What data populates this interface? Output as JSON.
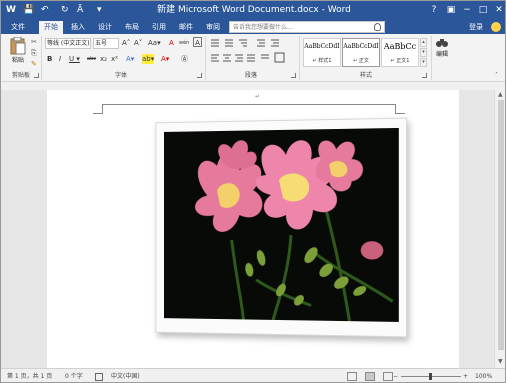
{
  "window": {
    "title": "新建 Microsoft Word Document.docx - Word",
    "help": "?",
    "ribbon_display": "▣",
    "minimize": "−",
    "maximize": "□",
    "close": "✕"
  },
  "quick_access": {
    "word_logo": "W",
    "save": "💾",
    "undo": "↶",
    "redo": "↻",
    "format_painter": "Ā",
    "customize": "▾"
  },
  "tabs": [
    "文件",
    "开始",
    "插入",
    "设计",
    "布局",
    "引用",
    "邮件",
    "审阅",
    "视图"
  ],
  "active_tab": 1,
  "tell_me": {
    "placeholder": "告诉我您想要做什么..."
  },
  "login": "登录",
  "ribbon": {
    "clipboard": {
      "paste": "粘贴",
      "label": "剪贴板"
    },
    "font": {
      "font_name": "等线 (中文正文)",
      "font_size": "五号",
      "label": "字体",
      "row1": [
        "A˄",
        "A˅",
        "Aa▾",
        "A",
        "wén",
        "A"
      ],
      "row2": [
        "B",
        "I",
        "U ▾",
        "abc",
        "x₂",
        "x²",
        "A▾",
        "ab▾",
        "A▾",
        "Ⓐ"
      ]
    },
    "paragraph": {
      "label": "段落"
    },
    "styles": {
      "label": "样式",
      "items": [
        {
          "sample": "AaBbCcDdI",
          "name": "↵ 样式1"
        },
        {
          "sample": "AaBbCcDdI",
          "name": "↵ 正文"
        },
        {
          "sample": "AaBbCc",
          "name": "↵ 正文1"
        }
      ]
    },
    "editing": {
      "label": "编辑"
    }
  },
  "document": {
    "paragraph_mark": "↵"
  },
  "status": {
    "page": "第 1 页，共 1 页",
    "words": "0 个字",
    "language": "中文(中国)",
    "zoom": "100%"
  }
}
